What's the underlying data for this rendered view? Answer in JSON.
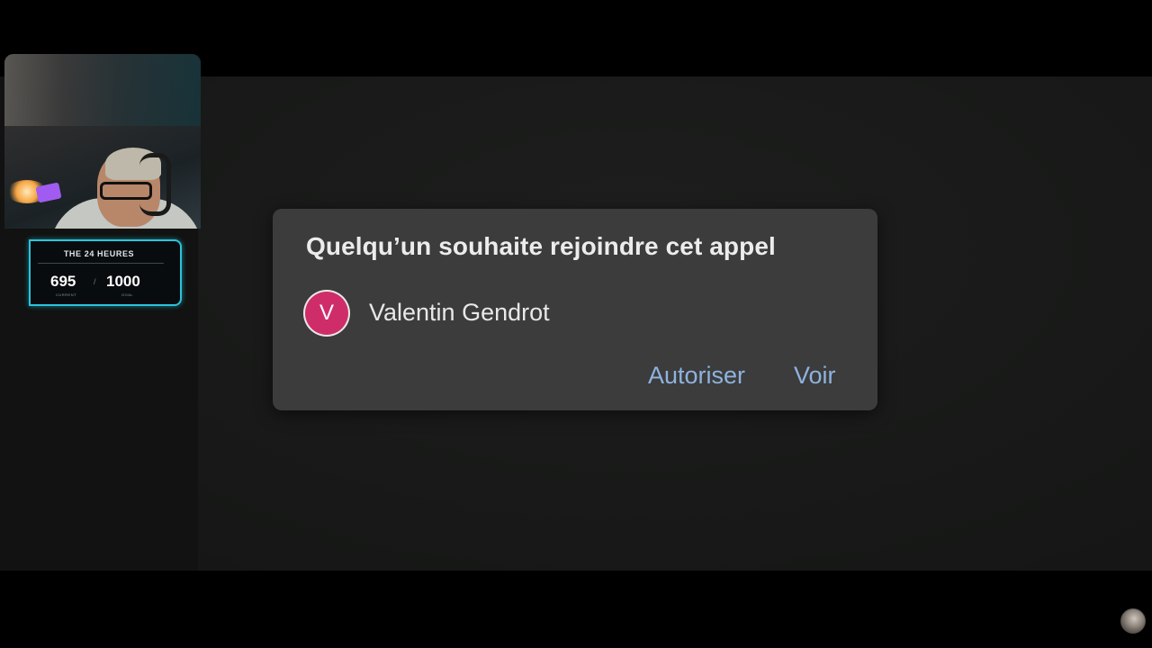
{
  "stream_overlay": {
    "goal_widget": {
      "title": "THE 24 HEURES",
      "current_value": "695",
      "current_label": "CURRENT",
      "separator": "/",
      "target_value": "1000",
      "target_label": "GOAL",
      "accent_color": "#2ac4dc"
    }
  },
  "notification": {
    "title": "Quelqu’un souhaite rejoindre cet appel",
    "caller": {
      "avatar_initial": "V",
      "avatar_color": "#cf2d6a",
      "name": "Valentin Gendrot"
    },
    "actions": {
      "allow_label": "Autoriser",
      "view_label": "Voir",
      "action_color": "#8fb2df"
    }
  },
  "icons": {
    "corner": "channel-avatar-icon"
  }
}
